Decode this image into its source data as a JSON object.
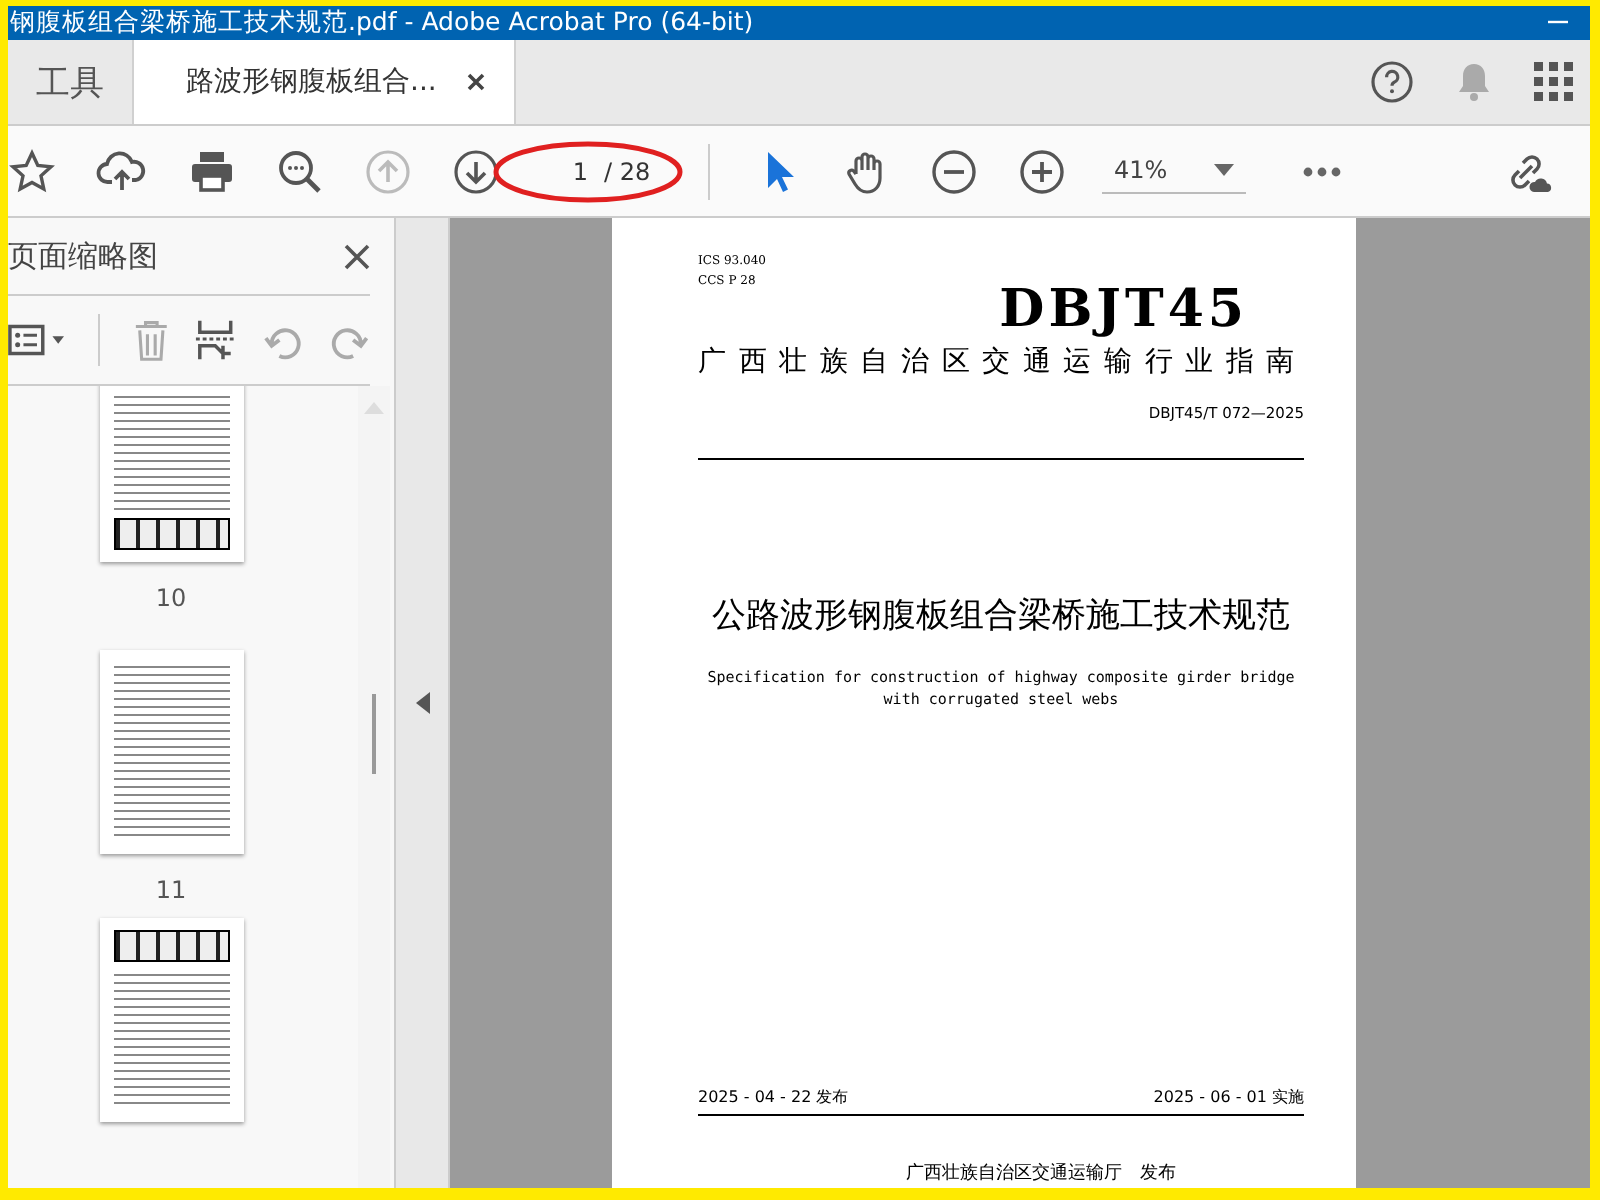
{
  "window": {
    "title": "钢腹板组合梁桥施工技术规范.pdf - Adobe Acrobat Pro (64-bit)"
  },
  "tabs": [
    {
      "label": "工具",
      "selected": false
    },
    {
      "label": "路波形钢腹板组合...",
      "selected": true
    }
  ],
  "toolbar": {
    "nav_buttons": [
      {
        "kind": "prev",
        "disabled": true
      },
      {
        "kind": "next",
        "disabled": false
      }
    ],
    "page_input": "1",
    "page_total": "/ 28",
    "zoom": "41%"
  },
  "sidebar": {
    "title": "页面缩略图",
    "thumbnails": [
      {
        "label": "10",
        "kind": "table-bottom"
      },
      {
        "label": "11",
        "kind": "text"
      },
      {
        "kind": "table-top"
      }
    ]
  },
  "document": {
    "meta": [
      "ICS  93.040",
      "CCS P 28"
    ],
    "code": "DBJT45",
    "category": "广西壮族自治区交通运输行业指南",
    "number": "DBJT45/T 072—2025",
    "title": "公路波形钢腹板组合梁桥施工技术规范",
    "subtitle": "Specification for construction of highway composite girder bridge with corrugated steel webs",
    "issue_date": "2025 - 04 - 22 发布",
    "effective_date": "2025 - 06 - 01 实施",
    "publisher": "广西壮族自治区交通运输厅　发布"
  }
}
